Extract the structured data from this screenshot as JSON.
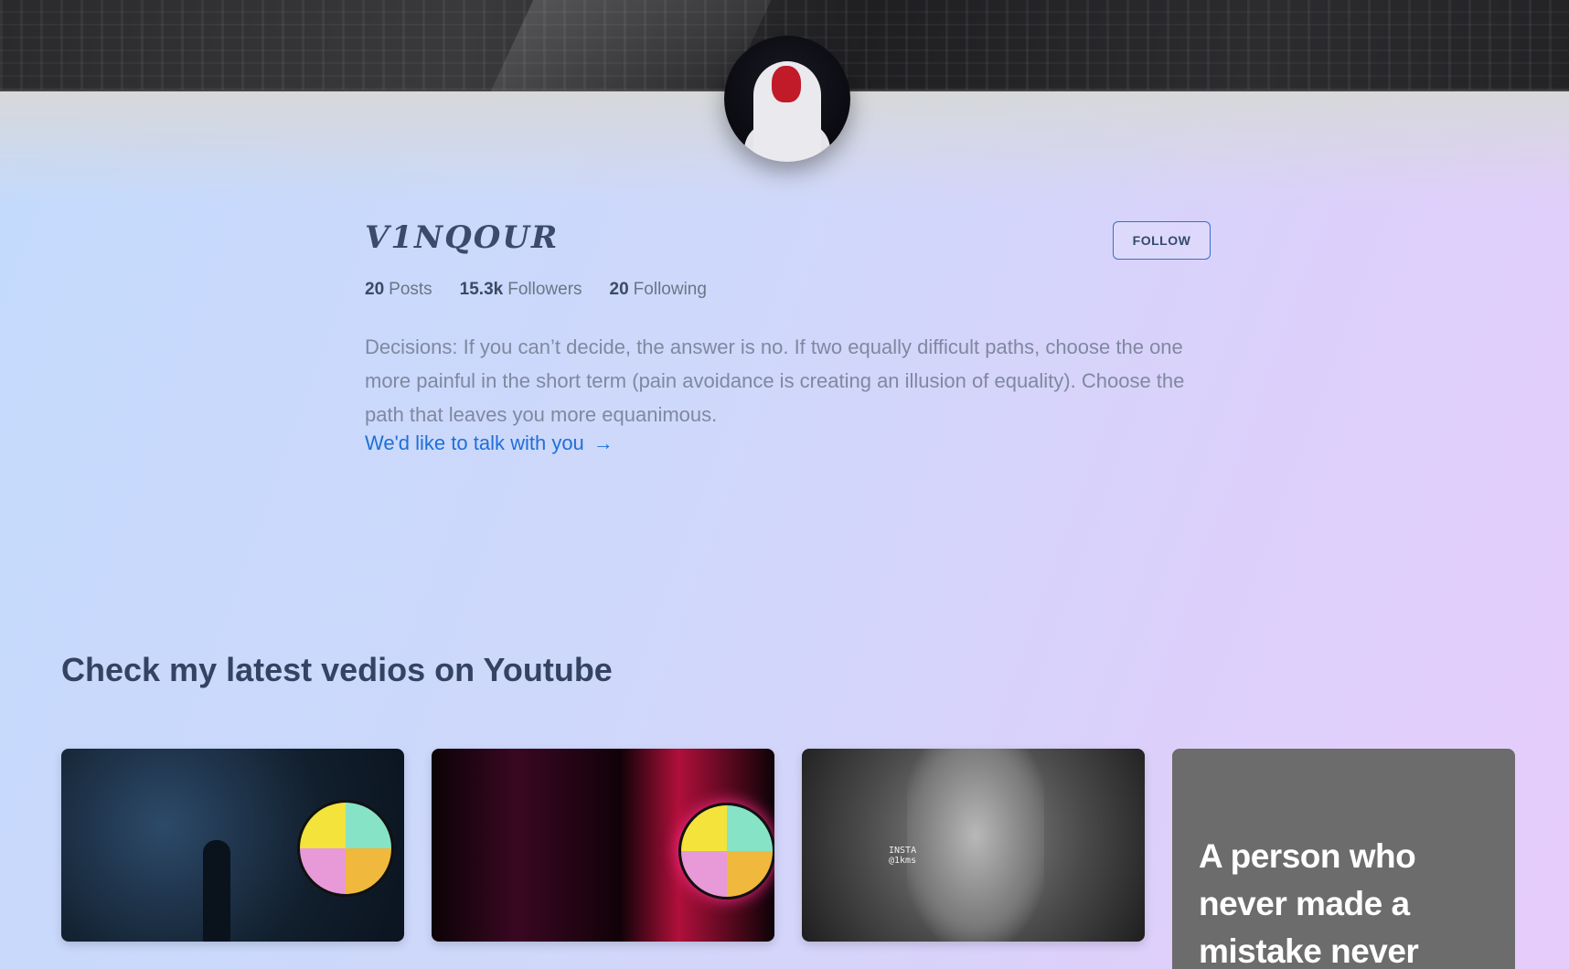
{
  "profile": {
    "name": "V1NQOUR",
    "follow_label": "FOLLOW",
    "stats": [
      {
        "count": "20",
        "label": "Posts"
      },
      {
        "count": "15.3k",
        "label": "Followers"
      },
      {
        "count": "20",
        "label": "Following"
      }
    ],
    "bio": "Decisions: If you can’t decide, the answer is no. If two equally difficult paths, choose the one more painful in the short term (pain avoidance is creating an illusion of equality). Choose the path that leaves you more equanimous.",
    "talk_link": "We'd like to talk with you",
    "talk_link_color": "#1e6fd9"
  },
  "videos": {
    "title": "Check my latest vedios on Youtube",
    "cards": [
      {
        "kind": "thumbnail",
        "icon": "logo-quadrant-icon"
      },
      {
        "kind": "thumbnail",
        "icon": "logo-quadrant-icon"
      },
      {
        "kind": "thumbnail",
        "caption": "INSTA\n@1kms"
      },
      {
        "kind": "quote",
        "text": "A person who never made a mistake never"
      }
    ]
  }
}
